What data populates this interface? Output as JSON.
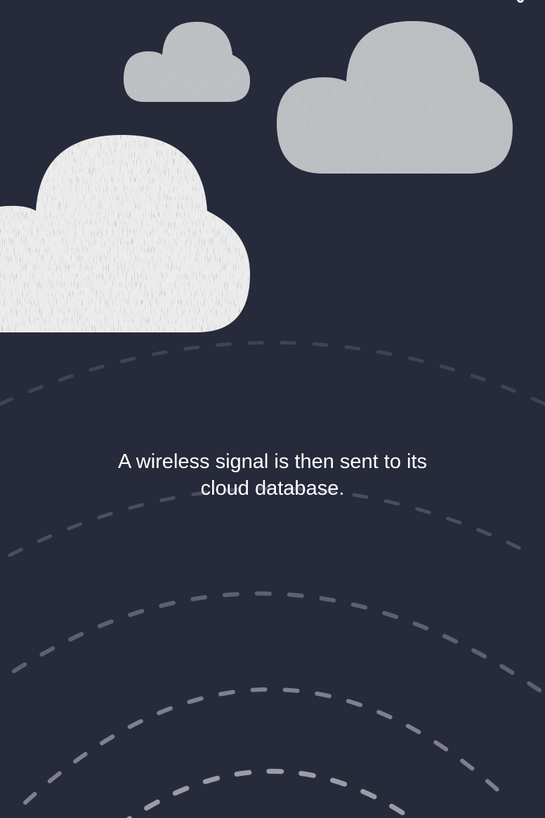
{
  "caption": {
    "line1": "A wireless signal is then sent to its",
    "line2": "cloud database."
  },
  "colors": {
    "background": "#262a3a",
    "cloud_bright": "#ececec",
    "cloud_grey": "#bebfc3",
    "signal_dash": "#9a9ca6",
    "text": "#ffffff"
  },
  "icons": [
    "cloud-icon",
    "wireless-signal-icon"
  ]
}
